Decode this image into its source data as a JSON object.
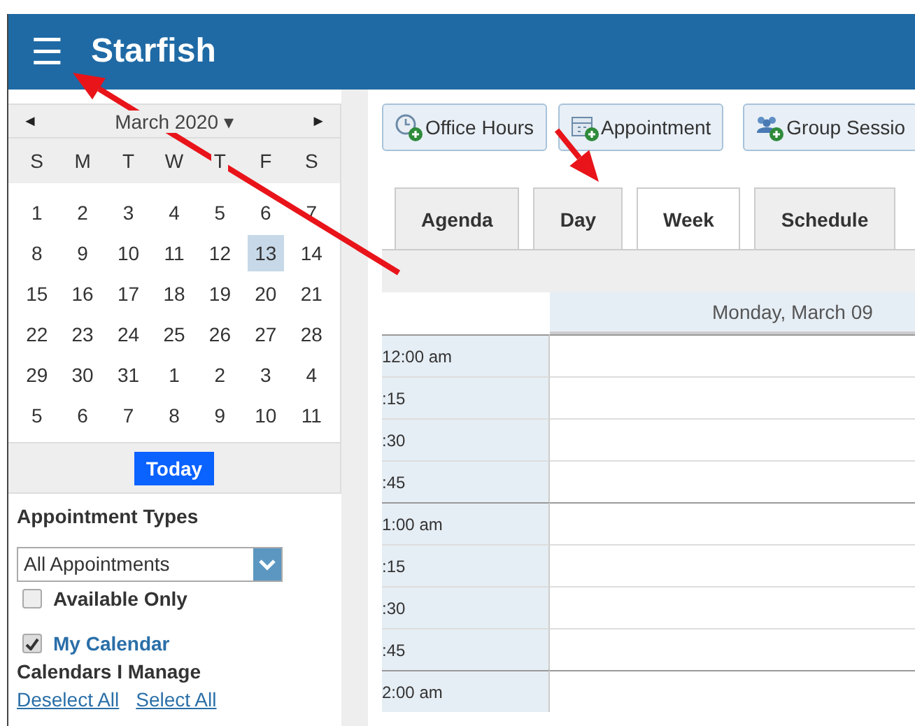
{
  "header": {
    "menu_icon": "☰",
    "title": "Starfish"
  },
  "calendar": {
    "prev": "◄",
    "month": "March 2020",
    "month_caret": "▾",
    "next": "►",
    "weekdays": [
      "S",
      "M",
      "T",
      "W",
      "T",
      "F",
      "S"
    ],
    "weeks": [
      [
        {
          "label": "1",
          "selected": false
        },
        {
          "label": "2",
          "selected": false
        },
        {
          "label": "3",
          "selected": false
        },
        {
          "label": "4",
          "selected": false
        },
        {
          "label": "5",
          "selected": false
        },
        {
          "label": "6",
          "selected": false
        },
        {
          "label": "7",
          "selected": false
        }
      ],
      [
        {
          "label": "8",
          "selected": false
        },
        {
          "label": "9",
          "selected": false
        },
        {
          "label": "10",
          "selected": false
        },
        {
          "label": "11",
          "selected": false
        },
        {
          "label": "12",
          "selected": false
        },
        {
          "label": "13",
          "selected": true
        },
        {
          "label": "14",
          "selected": false
        }
      ],
      [
        {
          "label": "15",
          "selected": false
        },
        {
          "label": "16",
          "selected": false
        },
        {
          "label": "17",
          "selected": false
        },
        {
          "label": "18",
          "selected": false
        },
        {
          "label": "19",
          "selected": false
        },
        {
          "label": "20",
          "selected": false
        },
        {
          "label": "21",
          "selected": false
        }
      ],
      [
        {
          "label": "22",
          "selected": false
        },
        {
          "label": "23",
          "selected": false
        },
        {
          "label": "24",
          "selected": false
        },
        {
          "label": "25",
          "selected": false
        },
        {
          "label": "26",
          "selected": false
        },
        {
          "label": "27",
          "selected": false
        },
        {
          "label": "28",
          "selected": false
        }
      ],
      [
        {
          "label": "29",
          "selected": false
        },
        {
          "label": "30",
          "selected": false
        },
        {
          "label": "31",
          "selected": false
        },
        {
          "label": "1",
          "selected": false
        },
        {
          "label": "2",
          "selected": false
        },
        {
          "label": "3",
          "selected": false
        },
        {
          "label": "4",
          "selected": false
        }
      ],
      [
        {
          "label": "5",
          "selected": false
        },
        {
          "label": "6",
          "selected": false
        },
        {
          "label": "7",
          "selected": false
        },
        {
          "label": "8",
          "selected": false
        },
        {
          "label": "9",
          "selected": false
        },
        {
          "label": "10",
          "selected": false
        },
        {
          "label": "11",
          "selected": false
        }
      ]
    ],
    "today_button": "Today"
  },
  "appointment_types": {
    "heading": "Appointment Types",
    "select_value": "All Appointments",
    "available_only": {
      "label": "Available Only",
      "checked": false
    }
  },
  "my_calendar": {
    "label": "My Calendar",
    "checked": true
  },
  "calendars_i_manage": {
    "heading": "Calendars I Manage",
    "links": [
      "Deselect All",
      "Select All"
    ]
  },
  "toolbar": [
    {
      "kind": "clock",
      "label": "Office Hours"
    },
    {
      "kind": "calendar",
      "label": "Appointment"
    },
    {
      "kind": "group",
      "label": "Group Sessio"
    }
  ],
  "tabs": [
    {
      "label": "Agenda",
      "selected": false
    },
    {
      "label": "Day",
      "selected": false
    },
    {
      "label": "Week",
      "selected": true
    },
    {
      "label": "Schedule",
      "selected": false
    }
  ],
  "grid": {
    "day_header": "Monday, March 09",
    "times": [
      "12:00 am",
      ":15",
      ":30",
      ":45",
      "1:00 am",
      ":15",
      ":30",
      ":45",
      "2:00 am"
    ]
  },
  "annotations": [
    {
      "kind": "arrow"
    },
    {
      "kind": "arrow"
    }
  ]
}
